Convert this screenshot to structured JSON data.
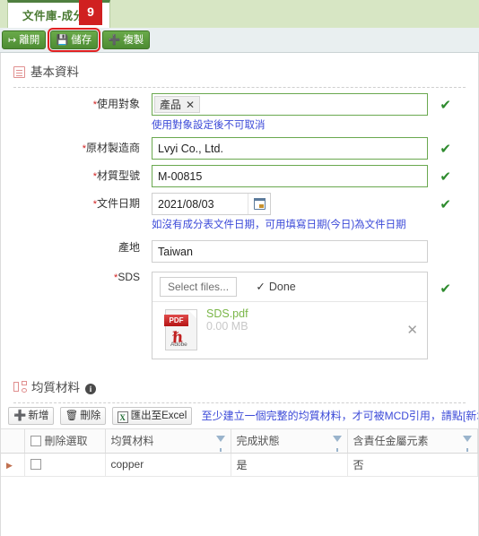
{
  "tab": {
    "label": "文件庫-成分表",
    "badge": "9"
  },
  "toolbar": {
    "exit": {
      "label": "離開",
      "icon": "exit-icon"
    },
    "save": {
      "label": "儲存",
      "icon": "save-disk-icon"
    },
    "copy": {
      "label": "複製",
      "icon": "plus-icon"
    }
  },
  "basic": {
    "section_title": "基本資料",
    "fields": {
      "target": {
        "label": "使用對象",
        "required": true,
        "tag": "產品",
        "tag_remove": "✕",
        "hint": "使用對象設定後不可取消",
        "valid": "✔"
      },
      "manufacturer": {
        "label": "原材製造商",
        "required": true,
        "value": "Lvyi Co., Ltd.",
        "valid": "✔"
      },
      "model": {
        "label": "材質型號",
        "required": true,
        "value": "M-00815",
        "valid": "✔"
      },
      "doc_date": {
        "label": "文件日期",
        "required": true,
        "value": "2021/08/03",
        "hint": "如沒有成分表文件日期，可用填寫日期(今日)為文件日期",
        "valid": "✔"
      },
      "origin": {
        "label": "產地",
        "required": false,
        "value": "Taiwan"
      },
      "sds": {
        "label": "SDS",
        "required": true,
        "select_files": "Select files...",
        "done_label": "Done",
        "done_check": "✓",
        "valid": "✔",
        "file": {
          "name": "SDS.pdf",
          "size": "0.00 MB",
          "type_label": "PDF",
          "brand": "Adobe",
          "remove": "✕"
        }
      }
    }
  },
  "homogeneous": {
    "section_title": "均質材料",
    "info_icon": "i",
    "tools": {
      "add": {
        "label": "新增",
        "icon": "plus-icon"
      },
      "delete": {
        "label": "刪除",
        "icon": "trash-icon"
      },
      "export": {
        "label": "匯出至Excel",
        "icon": "excel-icon",
        "badge": "X"
      },
      "note": "至少建立一個完整的均質材料，才可被MCD引用，請點[新增]建立。"
    },
    "grid": {
      "columns": [
        "",
        "刪除選取",
        "均質材料",
        "完成狀態",
        "含責任金屬元素"
      ],
      "rows": [
        {
          "expander": "▶",
          "selected": false,
          "material": "copper",
          "status": "是",
          "metal": "否"
        }
      ]
    }
  },
  "colors": {
    "tab_green": "#4a7a32",
    "toolbar_green": "#4d8c32",
    "badge_red": "#d02020",
    "hint_blue": "#3c4ad8",
    "valid_green": "#2e8b2e",
    "link_blue": "#5b86c7",
    "file_green": "#7ab648"
  }
}
